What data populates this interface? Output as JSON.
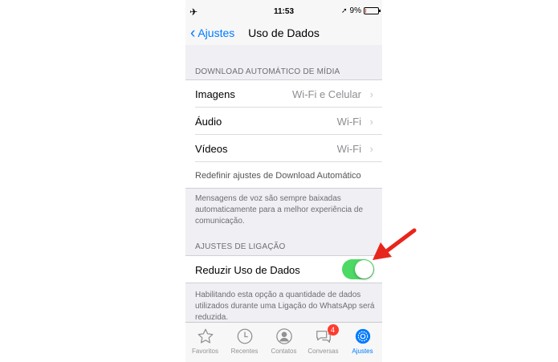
{
  "status_bar": {
    "time": "11:53",
    "battery": "9%",
    "battery_level": 0.09
  },
  "nav": {
    "back_label": "Ajustes",
    "title": "Uso de Dados"
  },
  "download_section": {
    "header": "DOWNLOAD AUTOMÁTICO DE MÍDIA",
    "rows": [
      {
        "label": "Imagens",
        "value": "Wi-Fi e Celular"
      },
      {
        "label": "Áudio",
        "value": "Wi-Fi"
      },
      {
        "label": "Vídeos",
        "value": "Wi-Fi"
      }
    ],
    "reset_label": "Redefinir ajustes de Download Automático",
    "footer": "Mensagens de voz são sempre baixadas automaticamente para a melhor experiência de comunicação."
  },
  "call_section": {
    "header": "AJUSTES DE LIGAÇÃO",
    "toggle_label": "Reduzir Uso de Dados",
    "toggle_on": true,
    "footer": "Habilitando esta opção a quantidade de dados utilizados durante uma Ligação do WhatsApp será reduzida."
  },
  "tabbar": {
    "tabs": [
      {
        "label": "Favoritos",
        "icon": "star-icon"
      },
      {
        "label": "Recentes",
        "icon": "clock-icon"
      },
      {
        "label": "Contatos",
        "icon": "contact-icon"
      },
      {
        "label": "Conversas",
        "icon": "chat-bubbles-icon",
        "badge": "4"
      },
      {
        "label": "Ajustes",
        "icon": "gear-icon",
        "active": true
      }
    ]
  },
  "colors": {
    "accent": "#007aff",
    "toggle_on": "#4cd964",
    "badge": "#ff3b30",
    "arrow": "#e8251c"
  }
}
